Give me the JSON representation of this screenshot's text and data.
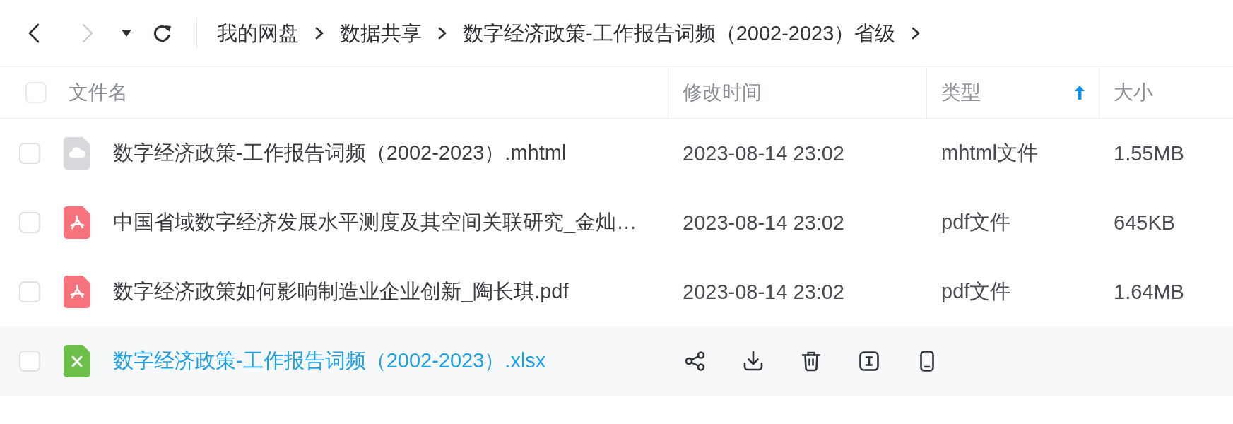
{
  "nav": {
    "back": {
      "disabled": false
    },
    "forward": {
      "disabled": true
    }
  },
  "breadcrumb": [
    {
      "label": "我的网盘"
    },
    {
      "label": "数据共享"
    },
    {
      "label": "数字经济政策-工作报告词频（2002-2023）省级"
    }
  ],
  "table": {
    "select_all": {
      "checked": false
    },
    "columns": [
      {
        "label": "文件名"
      },
      {
        "label": "修改时间"
      },
      {
        "label": "类型",
        "sorted": true
      },
      {
        "label": "大小"
      }
    ],
    "rows": [
      {
        "kind": "web",
        "name": "数字经济政策-工作报告词频（2002-2023）.mhtml",
        "modified": "2023-08-14 23:02",
        "type": "mhtml文件",
        "size": "1.55MB",
        "checked": false,
        "hovered": false
      },
      {
        "kind": "pdf",
        "name": "中国省域数字经济发展水平测度及其空间关联研究_金灿…",
        "modified": "2023-08-14 23:02",
        "type": "pdf文件",
        "size": "645KB",
        "checked": false,
        "hovered": false
      },
      {
        "kind": "pdf",
        "name": "数字经济政策如何影响制造业企业创新_陶长琪.pdf",
        "modified": "2023-08-14 23:02",
        "type": "pdf文件",
        "size": "1.64MB",
        "checked": false,
        "hovered": false
      },
      {
        "kind": "sheet",
        "name": "数字经济政策-工作报告词频（2002-2023）.xlsx",
        "checked": false,
        "hovered": true
      }
    ]
  }
}
